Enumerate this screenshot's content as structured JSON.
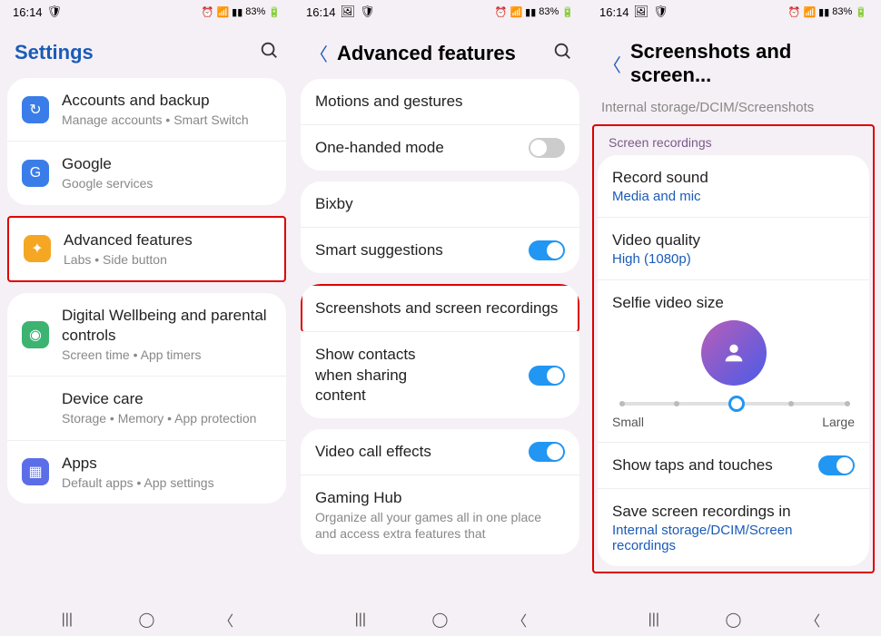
{
  "status": {
    "time": "16:14",
    "battery": "83%"
  },
  "screen1": {
    "title": "Settings",
    "items": [
      {
        "title": "Accounts and backup",
        "sub": "Manage accounts  •  Smart Switch"
      },
      {
        "title": "Google",
        "sub": "Google services"
      },
      {
        "title": "Advanced features",
        "sub": "Labs  •  Side button"
      },
      {
        "title": "Digital Wellbeing and parental controls",
        "sub": "Screen time  •  App timers"
      },
      {
        "title": "Device care",
        "sub": "Storage  •  Memory  •  App protection"
      },
      {
        "title": "Apps",
        "sub": "Default apps  •  App settings"
      }
    ]
  },
  "screen2": {
    "title": "Advanced features",
    "group1": [
      {
        "title": "Motions and gestures"
      },
      {
        "title": "One-handed mode",
        "toggle": "off"
      }
    ],
    "group2": [
      {
        "title": "Bixby"
      },
      {
        "title": "Smart suggestions",
        "toggle": "on"
      }
    ],
    "group3": [
      {
        "title": "Screenshots and screen recordings"
      },
      {
        "title": "Show contacts when sharing content",
        "toggle": "on"
      }
    ],
    "group4": [
      {
        "title": "Video call effects",
        "toggle": "on"
      },
      {
        "title": "Gaming Hub",
        "sub": "Organize all your games all in one place and access extra features that"
      }
    ]
  },
  "screen3": {
    "title": "Screenshots and screen...",
    "breadcrumb_cut": "Internal storage/DCIM/Screenshots",
    "section": "Screen recordings",
    "record_sound": {
      "title": "Record sound",
      "value": "Media and mic"
    },
    "video_quality": {
      "title": "Video quality",
      "value": "High (1080p)"
    },
    "selfie": {
      "title": "Selfie video size",
      "small": "Small",
      "large": "Large"
    },
    "show_taps": {
      "title": "Show taps and touches"
    },
    "save_in": {
      "title": "Save screen recordings in",
      "value": "Internal storage/DCIM/Screen recordings"
    }
  }
}
